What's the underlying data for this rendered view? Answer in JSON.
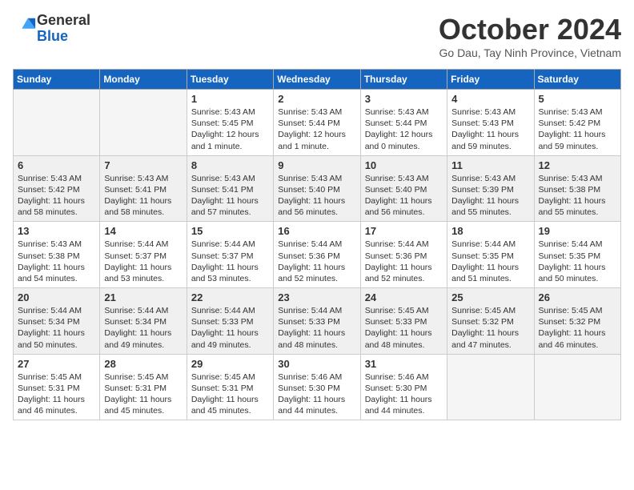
{
  "logo": {
    "general": "General",
    "blue": "Blue"
  },
  "header": {
    "month_title": "October 2024",
    "location": "Go Dau, Tay Ninh Province, Vietnam"
  },
  "weekdays": [
    "Sunday",
    "Monday",
    "Tuesday",
    "Wednesday",
    "Thursday",
    "Friday",
    "Saturday"
  ],
  "weeks": [
    [
      {
        "day": "",
        "text": ""
      },
      {
        "day": "",
        "text": ""
      },
      {
        "day": "1",
        "text": "Sunrise: 5:43 AM\nSunset: 5:45 PM\nDaylight: 12 hours\nand 1 minute."
      },
      {
        "day": "2",
        "text": "Sunrise: 5:43 AM\nSunset: 5:44 PM\nDaylight: 12 hours\nand 1 minute."
      },
      {
        "day": "3",
        "text": "Sunrise: 5:43 AM\nSunset: 5:44 PM\nDaylight: 12 hours\nand 0 minutes."
      },
      {
        "day": "4",
        "text": "Sunrise: 5:43 AM\nSunset: 5:43 PM\nDaylight: 11 hours\nand 59 minutes."
      },
      {
        "day": "5",
        "text": "Sunrise: 5:43 AM\nSunset: 5:42 PM\nDaylight: 11 hours\nand 59 minutes."
      }
    ],
    [
      {
        "day": "6",
        "text": "Sunrise: 5:43 AM\nSunset: 5:42 PM\nDaylight: 11 hours\nand 58 minutes."
      },
      {
        "day": "7",
        "text": "Sunrise: 5:43 AM\nSunset: 5:41 PM\nDaylight: 11 hours\nand 58 minutes."
      },
      {
        "day": "8",
        "text": "Sunrise: 5:43 AM\nSunset: 5:41 PM\nDaylight: 11 hours\nand 57 minutes."
      },
      {
        "day": "9",
        "text": "Sunrise: 5:43 AM\nSunset: 5:40 PM\nDaylight: 11 hours\nand 56 minutes."
      },
      {
        "day": "10",
        "text": "Sunrise: 5:43 AM\nSunset: 5:40 PM\nDaylight: 11 hours\nand 56 minutes."
      },
      {
        "day": "11",
        "text": "Sunrise: 5:43 AM\nSunset: 5:39 PM\nDaylight: 11 hours\nand 55 minutes."
      },
      {
        "day": "12",
        "text": "Sunrise: 5:43 AM\nSunset: 5:38 PM\nDaylight: 11 hours\nand 55 minutes."
      }
    ],
    [
      {
        "day": "13",
        "text": "Sunrise: 5:43 AM\nSunset: 5:38 PM\nDaylight: 11 hours\nand 54 minutes."
      },
      {
        "day": "14",
        "text": "Sunrise: 5:44 AM\nSunset: 5:37 PM\nDaylight: 11 hours\nand 53 minutes."
      },
      {
        "day": "15",
        "text": "Sunrise: 5:44 AM\nSunset: 5:37 PM\nDaylight: 11 hours\nand 53 minutes."
      },
      {
        "day": "16",
        "text": "Sunrise: 5:44 AM\nSunset: 5:36 PM\nDaylight: 11 hours\nand 52 minutes."
      },
      {
        "day": "17",
        "text": "Sunrise: 5:44 AM\nSunset: 5:36 PM\nDaylight: 11 hours\nand 52 minutes."
      },
      {
        "day": "18",
        "text": "Sunrise: 5:44 AM\nSunset: 5:35 PM\nDaylight: 11 hours\nand 51 minutes."
      },
      {
        "day": "19",
        "text": "Sunrise: 5:44 AM\nSunset: 5:35 PM\nDaylight: 11 hours\nand 50 minutes."
      }
    ],
    [
      {
        "day": "20",
        "text": "Sunrise: 5:44 AM\nSunset: 5:34 PM\nDaylight: 11 hours\nand 50 minutes."
      },
      {
        "day": "21",
        "text": "Sunrise: 5:44 AM\nSunset: 5:34 PM\nDaylight: 11 hours\nand 49 minutes."
      },
      {
        "day": "22",
        "text": "Sunrise: 5:44 AM\nSunset: 5:33 PM\nDaylight: 11 hours\nand 49 minutes."
      },
      {
        "day": "23",
        "text": "Sunrise: 5:44 AM\nSunset: 5:33 PM\nDaylight: 11 hours\nand 48 minutes."
      },
      {
        "day": "24",
        "text": "Sunrise: 5:45 AM\nSunset: 5:33 PM\nDaylight: 11 hours\nand 48 minutes."
      },
      {
        "day": "25",
        "text": "Sunrise: 5:45 AM\nSunset: 5:32 PM\nDaylight: 11 hours\nand 47 minutes."
      },
      {
        "day": "26",
        "text": "Sunrise: 5:45 AM\nSunset: 5:32 PM\nDaylight: 11 hours\nand 46 minutes."
      }
    ],
    [
      {
        "day": "27",
        "text": "Sunrise: 5:45 AM\nSunset: 5:31 PM\nDaylight: 11 hours\nand 46 minutes."
      },
      {
        "day": "28",
        "text": "Sunrise: 5:45 AM\nSunset: 5:31 PM\nDaylight: 11 hours\nand 45 minutes."
      },
      {
        "day": "29",
        "text": "Sunrise: 5:45 AM\nSunset: 5:31 PM\nDaylight: 11 hours\nand 45 minutes."
      },
      {
        "day": "30",
        "text": "Sunrise: 5:46 AM\nSunset: 5:30 PM\nDaylight: 11 hours\nand 44 minutes."
      },
      {
        "day": "31",
        "text": "Sunrise: 5:46 AM\nSunset: 5:30 PM\nDaylight: 11 hours\nand 44 minutes."
      },
      {
        "day": "",
        "text": ""
      },
      {
        "day": "",
        "text": ""
      }
    ]
  ]
}
